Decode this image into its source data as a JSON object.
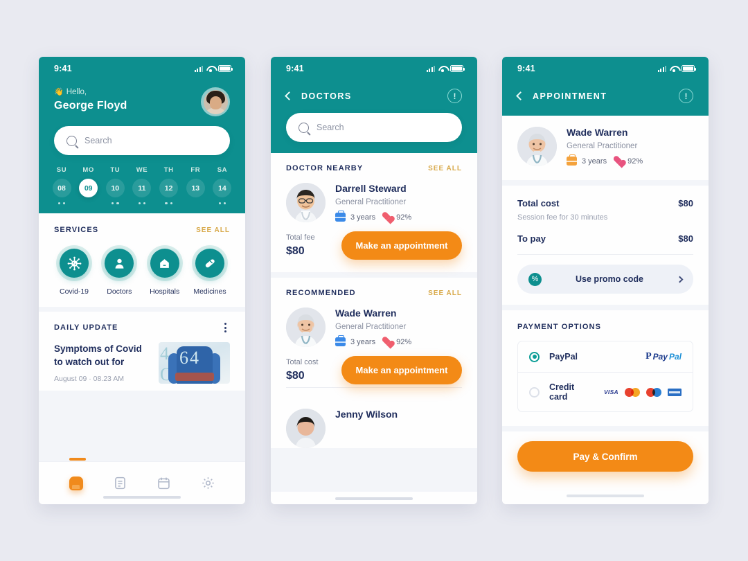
{
  "status_bar": {
    "time": "9:41",
    "signal_icon": "cellular-signal-icon",
    "wifi_icon": "wifi-icon",
    "battery_icon": "battery-icon"
  },
  "phone1": {
    "greeting_prefix": "Hello,",
    "wave_emoji": "👋",
    "user_name": "George Floyd",
    "avatar_icon": "user-avatar",
    "search": {
      "placeholder": "Search",
      "icon": "search-icon"
    },
    "calendar": {
      "days": [
        {
          "name": "SU",
          "num": "08",
          "active": false,
          "dots": 2
        },
        {
          "name": "MO",
          "num": "09",
          "active": true,
          "dots": 0
        },
        {
          "name": "TU",
          "num": "10",
          "active": false,
          "dots": 2
        },
        {
          "name": "WE",
          "num": "11",
          "active": false,
          "dots": 2
        },
        {
          "name": "TH",
          "num": "12",
          "active": false,
          "dots": 2
        },
        {
          "name": "FR",
          "num": "13",
          "active": false,
          "dots": 0
        },
        {
          "name": "SA",
          "num": "14",
          "active": false,
          "dots": 2
        }
      ]
    },
    "services": {
      "title": "SERVICES",
      "see_all": "SEE ALL",
      "items": [
        {
          "label": "Covid-19",
          "icon": "virus-icon"
        },
        {
          "label": "Doctors",
          "icon": "person-icon"
        },
        {
          "label": "Hospitals",
          "icon": "hospital-icon"
        },
        {
          "label": "Medicines",
          "icon": "pill-icon"
        }
      ]
    },
    "daily_update": {
      "title": "DAILY UPDATE",
      "menu_icon": "kebab-menu-icon",
      "headline": "Symptoms of Covid to watch out for",
      "date": "August 09 · 08.23 AM",
      "thumbnail": "covid-news-photo"
    },
    "bottom_nav": [
      {
        "icon": "home-icon",
        "active": true
      },
      {
        "icon": "document-icon",
        "active": false
      },
      {
        "icon": "calendar-icon",
        "active": false
      },
      {
        "icon": "settings-gear-icon",
        "active": false
      }
    ]
  },
  "phone2": {
    "back_icon": "chevron-left-icon",
    "title": "DOCTORS",
    "info_icon": "info-circle-icon",
    "search": {
      "placeholder": "Search",
      "icon": "search-icon"
    },
    "sections": [
      {
        "title": "DOCTOR NEARBY",
        "see_all": "SEE ALL",
        "doctors": [
          {
            "name": "Darrell Steward",
            "role": "General Practitioner",
            "experience": "3 years",
            "rating": "92%",
            "fee_label": "Total fee",
            "fee_amount": "$80",
            "cta": "Make an appointment",
            "avatar": "doctor-darrell-photo",
            "experience_icon": "briefcase-icon",
            "rating_icon": "heart-icon"
          }
        ]
      },
      {
        "title": "RECOMMENDED",
        "see_all": "SEE ALL",
        "doctors": [
          {
            "name": "Wade Warren",
            "role": "General Practitioner",
            "experience": "3 years",
            "rating": "92%",
            "fee_label": "Total cost",
            "fee_amount": "$80",
            "cta": "Make an appointment",
            "avatar": "doctor-wade-photo",
            "experience_icon": "briefcase-icon",
            "rating_icon": "heart-icon"
          },
          {
            "name": "Jenny Wilson",
            "avatar": "doctor-jenny-photo"
          }
        ]
      }
    ]
  },
  "phone3": {
    "back_icon": "chevron-left-icon",
    "title": "APPOINTMENT",
    "info_icon": "info-circle-icon",
    "doctor": {
      "name": "Wade Warren",
      "role": "General Practitioner",
      "experience": "3 years",
      "rating": "92%",
      "avatar": "doctor-wade-photo",
      "experience_icon": "briefcase-icon",
      "rating_icon": "heart-icon"
    },
    "cost": {
      "total_label": "Total cost",
      "total_value": "$80",
      "session_note": "Session fee for 30 minutes",
      "topay_label": "To pay",
      "topay_value": "$80",
      "promo_label": "Use promo code",
      "promo_icon": "promo-badge-icon",
      "promo_chevron": "chevron-right-icon"
    },
    "payment": {
      "title": "PAYMENT OPTIONS",
      "options": [
        {
          "label": "PayPal",
          "selected": true,
          "brand": "paypal-logo"
        },
        {
          "label": "Credit card",
          "selected": false,
          "brand": "card-logos"
        }
      ],
      "paypal_word_1": "Pay",
      "paypal_word_2": "Pal",
      "visa_label": "VISA",
      "mastercard_icon": "mastercard-logo",
      "maestro_icon": "maestro-logo",
      "amex_icon": "amex-logo"
    },
    "confirm_button": "Pay & Confirm"
  },
  "colors": {
    "teal": "#0d8f8f",
    "orange": "#f38a16",
    "gold": "#d8a94a",
    "navy": "#1f2d5c",
    "page_bg": "#e9eaf1"
  }
}
